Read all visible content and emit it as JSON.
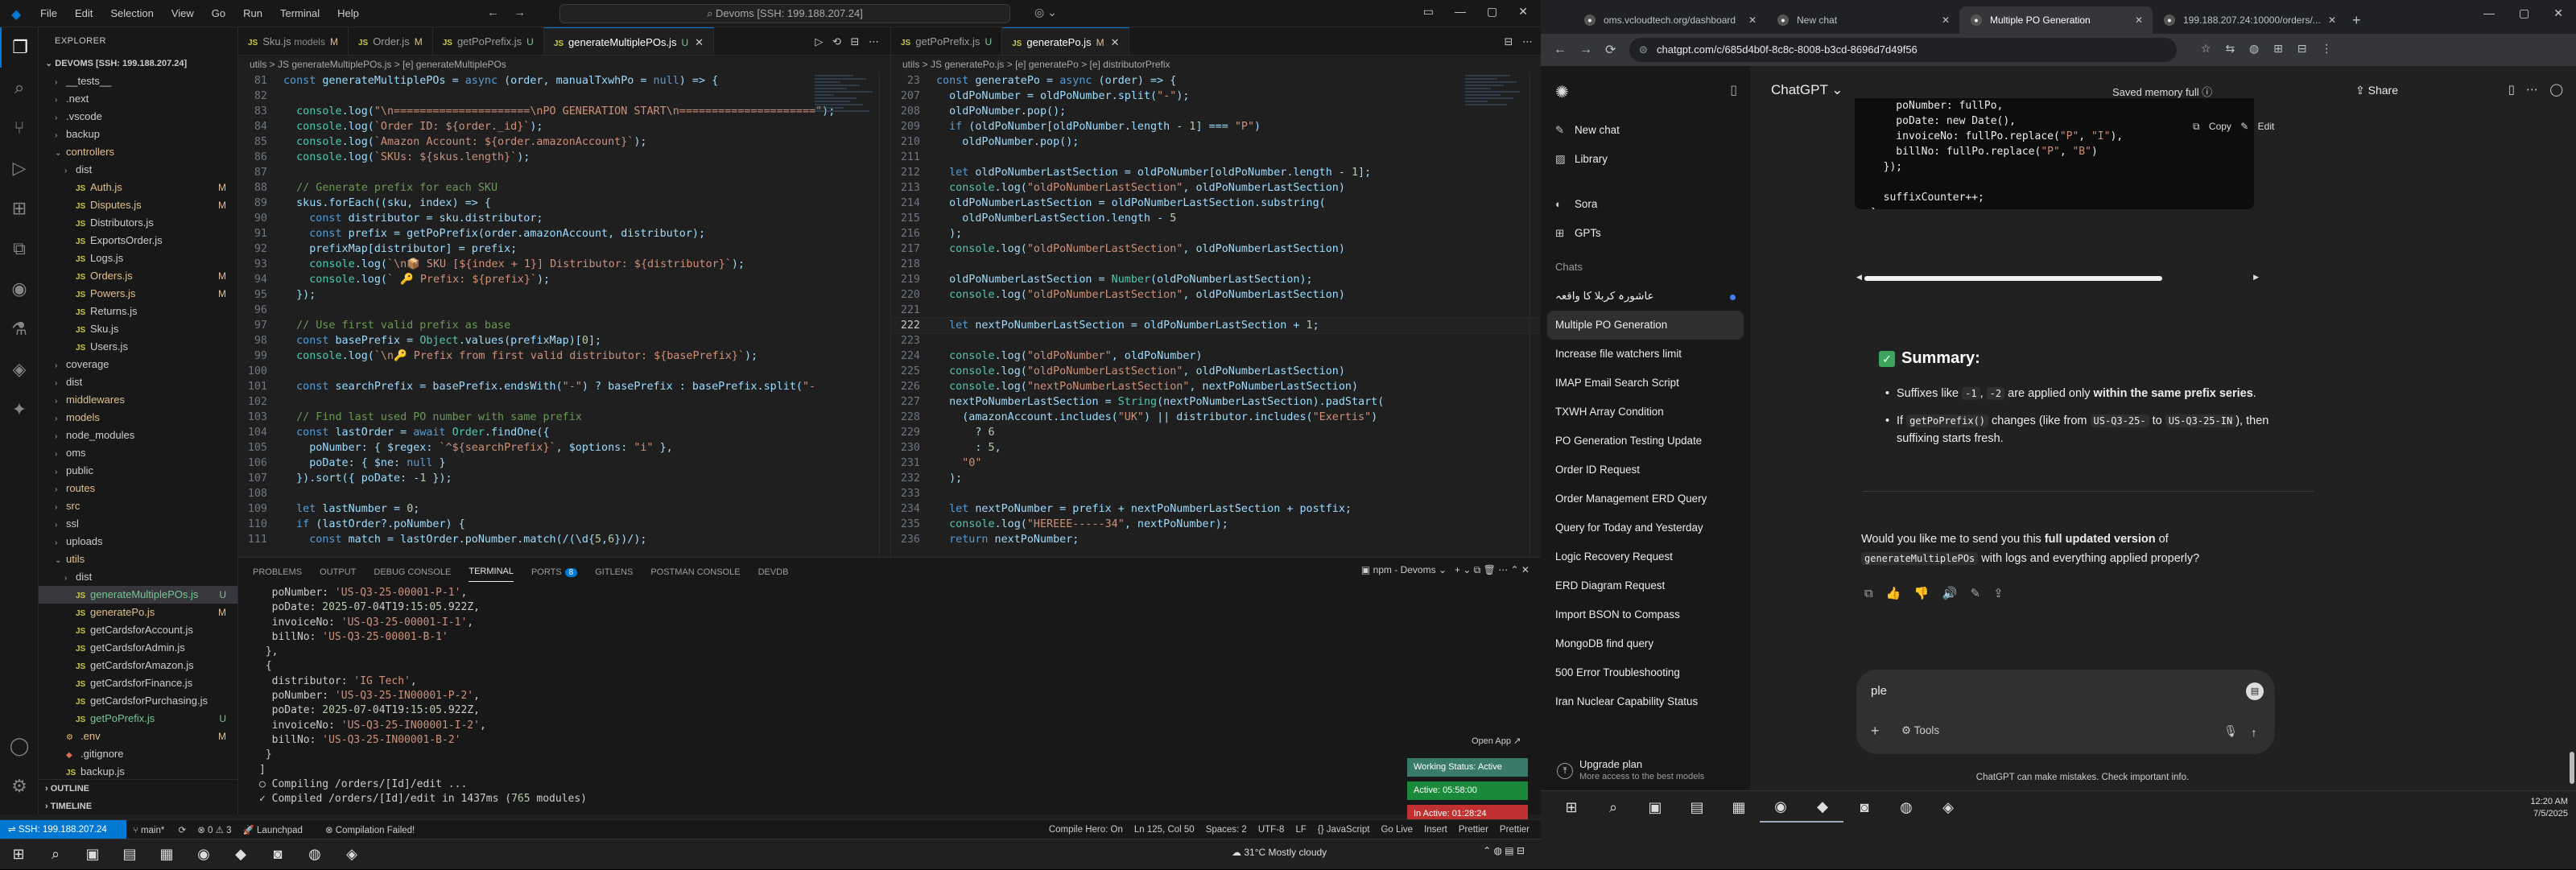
{
  "vscode": {
    "menu": [
      "File",
      "Edit",
      "Selection",
      "View",
      "Go",
      "Run",
      "Terminal",
      "Help"
    ],
    "command_center": "Devoms [SSH: 199.188.207.24]",
    "explorer": {
      "header": "EXPLORER",
      "root": "DEVOMS [SSH: 199.188.207.24]",
      "items": [
        {
          "label": "__tests__",
          "depth": 1,
          "type": "folder-closed",
          "status": ""
        },
        {
          "label": ".next",
          "depth": 1,
          "type": "folder-closed",
          "status": ""
        },
        {
          "label": ".vscode",
          "depth": 1,
          "type": "folder-closed",
          "status": ""
        },
        {
          "label": "backup",
          "depth": 1,
          "type": "folder-closed",
          "status": ""
        },
        {
          "label": "controllers",
          "depth": 1,
          "type": "folder-open",
          "status": "",
          "cls": "mod"
        },
        {
          "label": "dist",
          "depth": 2,
          "type": "folder-closed",
          "status": ""
        },
        {
          "label": "Auth.js",
          "depth": 2,
          "type": "js",
          "status": "M",
          "cls": "mod"
        },
        {
          "label": "Disputes.js",
          "depth": 2,
          "type": "js",
          "status": "M",
          "cls": "mod"
        },
        {
          "label": "Distributors.js",
          "depth": 2,
          "type": "js",
          "status": "",
          "cls": ""
        },
        {
          "label": "ExportsOrder.js",
          "depth": 2,
          "type": "js",
          "status": "",
          "cls": ""
        },
        {
          "label": "Logs.js",
          "depth": 2,
          "type": "js",
          "status": "",
          "cls": ""
        },
        {
          "label": "Orders.js",
          "depth": 2,
          "type": "js",
          "status": "M",
          "cls": "mod"
        },
        {
          "label": "Powers.js",
          "depth": 2,
          "type": "js",
          "status": "M",
          "cls": "mod"
        },
        {
          "label": "Returns.js",
          "depth": 2,
          "type": "js",
          "status": "",
          "cls": ""
        },
        {
          "label": "Sku.js",
          "depth": 2,
          "type": "js",
          "status": "",
          "cls": ""
        },
        {
          "label": "Users.js",
          "depth": 2,
          "type": "js",
          "status": "",
          "cls": ""
        },
        {
          "label": "coverage",
          "depth": 1,
          "type": "folder-closed",
          "status": ""
        },
        {
          "label": "dist",
          "depth": 1,
          "type": "folder-closed",
          "status": ""
        },
        {
          "label": "middlewares",
          "depth": 1,
          "type": "folder-closed",
          "status": "",
          "cls": "mod"
        },
        {
          "label": "models",
          "depth": 1,
          "type": "folder-closed",
          "status": "",
          "cls": "mod"
        },
        {
          "label": "node_modules",
          "depth": 1,
          "type": "folder-closed",
          "status": ""
        },
        {
          "label": "oms",
          "depth": 1,
          "type": "folder-closed",
          "status": ""
        },
        {
          "label": "public",
          "depth": 1,
          "type": "folder-closed",
          "status": ""
        },
        {
          "label": "routes",
          "depth": 1,
          "type": "folder-closed",
          "status": "",
          "cls": "mod"
        },
        {
          "label": "src",
          "depth": 1,
          "type": "folder-closed",
          "status": "",
          "cls": "mod"
        },
        {
          "label": "ssl",
          "depth": 1,
          "type": "folder-closed",
          "status": ""
        },
        {
          "label": "uploads",
          "depth": 1,
          "type": "folder-closed",
          "status": ""
        },
        {
          "label": "utils",
          "depth": 1,
          "type": "folder-open",
          "status": "",
          "cls": "mod"
        },
        {
          "label": "dist",
          "depth": 2,
          "type": "folder-closed",
          "status": ""
        },
        {
          "label": "generateMultiplePOs.js",
          "depth": 2,
          "type": "js",
          "status": "U",
          "cls": "unt",
          "sel": true
        },
        {
          "label": "generatePo.js",
          "depth": 2,
          "type": "js",
          "status": "M",
          "cls": "mod"
        },
        {
          "label": "getCardsforAccount.js",
          "depth": 2,
          "type": "js",
          "status": "",
          "cls": ""
        },
        {
          "label": "getCardsforAdmin.js",
          "depth": 2,
          "type": "js",
          "status": "",
          "cls": ""
        },
        {
          "label": "getCardsforAmazon.js",
          "depth": 2,
          "type": "js",
          "status": "",
          "cls": ""
        },
        {
          "label": "getCardsforFinance.js",
          "depth": 2,
          "type": "js",
          "status": "",
          "cls": ""
        },
        {
          "label": "getCardsforPurchasing.js",
          "depth": 2,
          "type": "js",
          "status": "",
          "cls": ""
        },
        {
          "label": "getPoPrefix.js",
          "depth": 2,
          "type": "js",
          "status": "U",
          "cls": "unt"
        },
        {
          "label": ".env",
          "depth": 1,
          "type": "env",
          "status": "M",
          "cls": "mod"
        },
        {
          "label": ".gitignore",
          "depth": 1,
          "type": "git",
          "status": ""
        },
        {
          "label": "backup.js",
          "depth": 1,
          "type": "js",
          "status": "",
          "cls": ""
        }
      ],
      "outline": "OUTLINE",
      "timeline": "TIMELINE"
    },
    "editor1": {
      "tabs": [
        {
          "label": "Sku.js",
          "extra": "models",
          "flag": "M",
          "active": false
        },
        {
          "label": "Order.js",
          "extra": "",
          "flag": "M",
          "active": false
        },
        {
          "label": "getPoPrefix.js",
          "extra": "",
          "flag": "U",
          "active": false
        },
        {
          "label": "generateMultiplePOs.js",
          "extra": "",
          "flag": "U",
          "active": true
        }
      ],
      "breadcrumb": "utils > JS generateMultiplePOs.js > [e] generateMultiplePOs",
      "lines": [
        {
          "n": "81",
          "t": "const generateMultiplePOs = async (order, manualTxwhPo = null) => {"
        },
        {
          "n": "82",
          "t": ""
        },
        {
          "n": "83",
          "t": "  console.log(\"\\n=====================\\nPO GENERATION START\\n=====================\");"
        },
        {
          "n": "84",
          "t": "  console.log(`Order ID: ${order._id}`);"
        },
        {
          "n": "85",
          "t": "  console.log(`Amazon Account: ${order.amazonAccount}`);"
        },
        {
          "n": "86",
          "t": "  console.log(`SKUs: ${skus.length}`);"
        },
        {
          "n": "87",
          "t": ""
        },
        {
          "n": "88",
          "t": "  // Generate prefix for each SKU"
        },
        {
          "n": "89",
          "t": "  skus.forEach((sku, index) => {"
        },
        {
          "n": "90",
          "t": "    const distributor = sku.distributor;"
        },
        {
          "n": "91",
          "t": "    const prefix = getPoPrefix(order.amazonAccount, distributor);"
        },
        {
          "n": "92",
          "t": "    prefixMap[distributor] = prefix;"
        },
        {
          "n": "93",
          "t": "    console.log(`\\n📦 SKU [${index + 1}] Distributor: ${distributor}`);"
        },
        {
          "n": "94",
          "t": "    console.log(` 🔑 Prefix: ${prefix}`);"
        },
        {
          "n": "95",
          "t": "  });"
        },
        {
          "n": "96",
          "t": ""
        },
        {
          "n": "97",
          "t": "  // Use first valid prefix as base"
        },
        {
          "n": "98",
          "t": "  const basePrefix = Object.values(prefixMap)[0];"
        },
        {
          "n": "99",
          "t": "  console.log(`\\n🔑 Prefix from first valid distributor: ${basePrefix}`);"
        },
        {
          "n": "100",
          "t": ""
        },
        {
          "n": "101",
          "t": "  const searchPrefix = basePrefix.endsWith(\"-\") ? basePrefix : basePrefix.split(\"-"
        },
        {
          "n": "102",
          "t": ""
        },
        {
          "n": "103",
          "t": "  // Find last used PO number with same prefix"
        },
        {
          "n": "104",
          "t": "  const lastOrder = await Order.findOne({"
        },
        {
          "n": "105",
          "t": "    poNumber: { $regex: `^${searchPrefix}`, $options: \"i\" },"
        },
        {
          "n": "106",
          "t": "    poDate: { $ne: null }"
        },
        {
          "n": "107",
          "t": "  }).sort({ poDate: -1 });"
        },
        {
          "n": "108",
          "t": ""
        },
        {
          "n": "109",
          "t": "  let lastNumber = 0;"
        },
        {
          "n": "110",
          "t": "  if (lastOrder?.poNumber) {"
        },
        {
          "n": "111",
          "t": "    const match = lastOrder.poNumber.match(/(\\d{5,6})/);"
        }
      ]
    },
    "editor2": {
      "tabs": [
        {
          "label": "getPoPrefix.js",
          "extra": "",
          "flag": "U",
          "active": false
        },
        {
          "label": "generatePo.js",
          "extra": "",
          "flag": "M",
          "active": true
        }
      ],
      "breadcrumb": "utils > JS generatePo.js > [e] generatePo > [e] distributorPrefix",
      "lines": [
        {
          "n": "23",
          "t": "const generatePo = async (order) => {"
        },
        {
          "n": "207",
          "t": "  oldPoNumber = oldPoNumber.split(\"-\");"
        },
        {
          "n": "208",
          "t": "  oldPoNumber.pop();"
        },
        {
          "n": "209",
          "t": "  if (oldPoNumber[oldPoNumber.length - 1] === \"P\")"
        },
        {
          "n": "210",
          "t": "    oldPoNumber.pop();"
        },
        {
          "n": "211",
          "t": ""
        },
        {
          "n": "212",
          "t": "  let oldPoNumberLastSection = oldPoNumber[oldPoNumber.length - 1];"
        },
        {
          "n": "213",
          "t": "  console.log(\"oldPoNumberLastSection\", oldPoNumberLastSection)"
        },
        {
          "n": "214",
          "t": "  oldPoNumberLastSection = oldPoNumberLastSection.substring("
        },
        {
          "n": "215",
          "t": "    oldPoNumberLastSection.length - 5"
        },
        {
          "n": "216",
          "t": "  );"
        },
        {
          "n": "217",
          "t": "  console.log(\"oldPoNumberLastSection\", oldPoNumberLastSection)"
        },
        {
          "n": "218",
          "t": ""
        },
        {
          "n": "219",
          "t": "  oldPoNumberLastSection = Number(oldPoNumberLastSection);"
        },
        {
          "n": "220",
          "t": "  console.log(\"oldPoNumberLastSection\", oldPoNumberLastSection)"
        },
        {
          "n": "221",
          "t": ""
        },
        {
          "n": "222",
          "t": "  let nextPoNumberLastSection = oldPoNumberLastSection + 1;",
          "cur": true
        },
        {
          "n": "223",
          "t": ""
        },
        {
          "n": "224",
          "t": "  console.log(\"oldPoNumber\", oldPoNumber)"
        },
        {
          "n": "225",
          "t": "  console.log(\"oldPoNumberLastSection\", oldPoNumberLastSection)"
        },
        {
          "n": "226",
          "t": "  console.log(\"nextPoNumberLastSection\", nextPoNumberLastSection)"
        },
        {
          "n": "227",
          "t": "  nextPoNumberLastSection = String(nextPoNumberLastSection).padStart("
        },
        {
          "n": "228",
          "t": "    (amazonAccount.includes(\"UK\") || distributor.includes(\"Exertis\")"
        },
        {
          "n": "229",
          "t": "      ? 6"
        },
        {
          "n": "230",
          "t": "      : 5,"
        },
        {
          "n": "231",
          "t": "    \"0\""
        },
        {
          "n": "232",
          "t": "  );"
        },
        {
          "n": "233",
          "t": ""
        },
        {
          "n": "234",
          "t": "  let nextPoNumber = prefix + nextPoNumberLastSection + postfix;"
        },
        {
          "n": "235",
          "t": "  console.log(\"HEREEE-----34\", nextPoNumber);"
        },
        {
          "n": "236",
          "t": "  return nextPoNumber;"
        }
      ]
    },
    "panel": {
      "tabs": [
        "PROBLEMS",
        "OUTPUT",
        "DEBUG CONSOLE",
        "TERMINAL",
        "PORTS",
        "GITLENS",
        "POSTMAN CONSOLE",
        "DEVDB"
      ],
      "ports_badge": "8",
      "terminal_name": "npm - Devoms",
      "lines": [
        "  poNumber: 'US-Q3-25-00001-P-1',",
        "  poDate: 2025-07-04T19:15:05.922Z,",
        "  invoiceNo: 'US-Q3-25-00001-I-1',",
        "  billNo: 'US-Q3-25-00001-B-1'",
        " },",
        " {",
        "  distributor: 'IG Tech',",
        "  poNumber: 'US-Q3-25-IN00001-P-2',",
        "  poDate: 2025-07-04T19:15:05.922Z,",
        "  invoiceNo: 'US-Q3-25-IN00001-I-2',",
        "  billNo: 'US-Q3-25-IN00001-B-2'",
        " }",
        "]",
        "○ Compiling /orders/[Id]/edit ...",
        "✓ Compiled /orders/[Id]/edit in 1437ms (765 modules)"
      ],
      "open_app": "Open App ↗",
      "working_status": "Working Status: Active",
      "active_time": "Active: 05:58:00",
      "inactive_time": "In Active: 01:28:24"
    },
    "status": {
      "remote": "SSH: 199.188.207.24",
      "branch": "main*",
      "errors": "⊗ 0 ⚠ 3",
      "launchpad": "Launchpad",
      "compile": "Compilation Failed!",
      "right": [
        "Compile Hero: On",
        "Ln 125, Col 50",
        "Spaces: 2",
        "UTF-8",
        "LF",
        "{} JavaScript",
        "Go Live",
        "Insert",
        "Prettier",
        "Prettier"
      ]
    },
    "weather": "31°C  Mostly cloudy"
  },
  "chrome": {
    "tabs": [
      {
        "label": "oms.vcloudtech.org/dashboard",
        "active": false
      },
      {
        "label": "New chat",
        "active": false
      },
      {
        "label": "Multiple PO Generation",
        "active": true
      },
      {
        "label": "199.188.207.24:10000/orders/...",
        "active": false
      }
    ],
    "url": "chatgpt.com/c/685d4b0f-8c8c-8008-b3cd-8696d7d49f56"
  },
  "chatgpt": {
    "sidebar": {
      "new_chat": "New chat",
      "library": "Library",
      "sora": "Sora",
      "gpts": "GPTs",
      "chats_header": "Chats",
      "chats": [
        {
          "label": "عاشورہ کربلا کا واقعہ",
          "active": false,
          "dot": true
        },
        {
          "label": "Multiple PO Generation",
          "active": true,
          "dot": false
        },
        {
          "label": "Increase file watchers limit",
          "active": false,
          "dot": false
        },
        {
          "label": "IMAP Email Search Script",
          "active": false,
          "dot": false
        },
        {
          "label": "TXWH Array Condition",
          "active": false,
          "dot": false
        },
        {
          "label": "PO Generation Testing Update",
          "active": false,
          "dot": false
        },
        {
          "label": "Order ID Request",
          "active": false,
          "dot": false
        },
        {
          "label": "Order Management ERD Query",
          "active": false,
          "dot": false
        },
        {
          "label": "Query for Today and Yesterday",
          "active": false,
          "dot": false
        },
        {
          "label": "Logic Recovery Request",
          "active": false,
          "dot": false
        },
        {
          "label": "ERD Diagram Request",
          "active": false,
          "dot": false
        },
        {
          "label": "Import BSON to Compass",
          "active": false,
          "dot": false
        },
        {
          "label": "MongoDB find query",
          "active": false,
          "dot": false
        },
        {
          "label": "500 Error Troubleshooting",
          "active": false,
          "dot": false
        },
        {
          "label": "Iran Nuclear Capability Status",
          "active": false,
          "dot": false
        }
      ],
      "upgrade_title": "Upgrade plan",
      "upgrade_sub": "More access to the best models"
    },
    "header": {
      "model": "ChatGPT ⌄",
      "memory": "Saved memory full ⓘ",
      "share": "Share"
    },
    "codeblock": {
      "copy": "Copy",
      "edit": "Edit",
      "lines": [
        "    poNumber: fullPo,",
        "    poDate: new Date(),",
        "    invoiceNo: fullPo.replace(\"P\", \"I\"),",
        "    billNo: fullPo.replace(\"P\", \"B\")",
        "  });",
        "",
        "  suffixCounter++;",
        "}"
      ]
    },
    "summary_title": "Summary:",
    "bullet1_a": "Suffixes like ",
    "bullet1_c1": "-1",
    "bullet1_b": ", ",
    "bullet1_c2": "-2",
    "bullet1_c": " are applied only ",
    "bullet1_bold": "within the same prefix series",
    "bullet1_d": ".",
    "bullet2_a": "If ",
    "bullet2_c1": "getPoPrefix()",
    "bullet2_b": " changes (like from ",
    "bullet2_c2": "US-Q3-25-",
    "bullet2_c": " to ",
    "bullet2_c3": "US-Q3-25-IN",
    "bullet2_d": "), then suffixing starts fresh.",
    "ask_a": "Would you like me to send you this ",
    "ask_bold": "full updated version",
    "ask_b": " of",
    "ask_code": "generateMultiplePOs",
    "ask_c": " with logs and everything applied properly?",
    "composer_text": "ple",
    "tools": "Tools",
    "disclaimer": "ChatGPT can make mistakes. Check important info."
  },
  "taskbar": {
    "time": "12:20 AM",
    "date": "7/5/2025"
  }
}
